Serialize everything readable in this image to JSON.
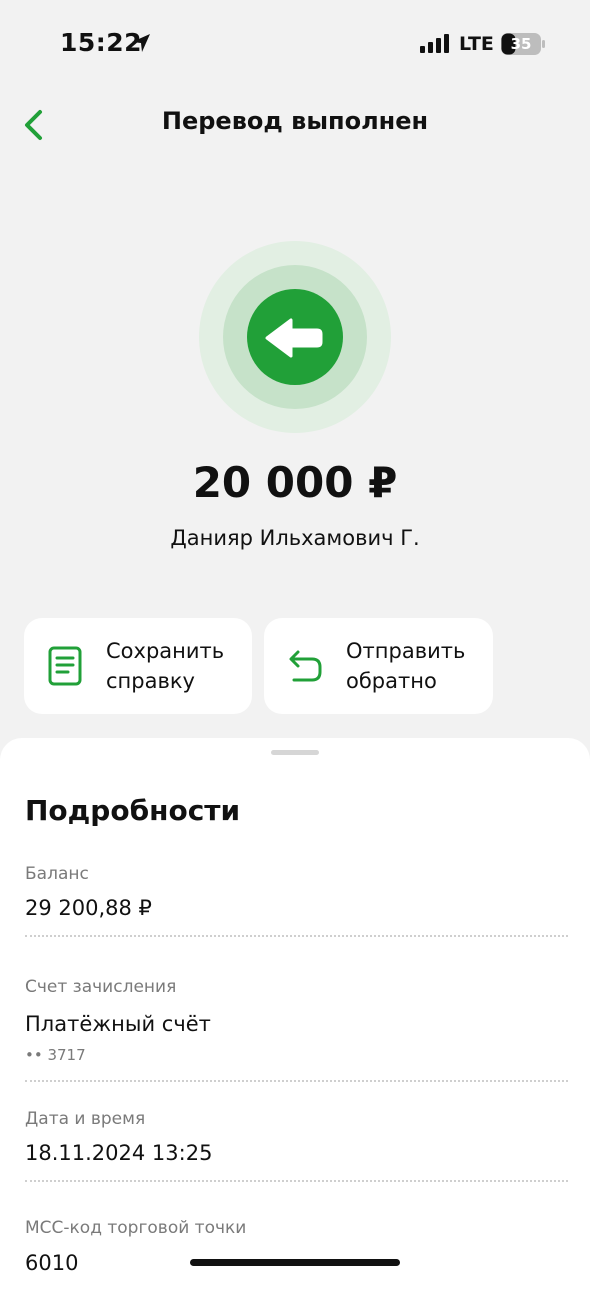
{
  "status_bar": {
    "time": "15:22",
    "network": "LTE",
    "battery": "35"
  },
  "header": {
    "title": "Перевод выполнен"
  },
  "transfer": {
    "amount": "20 000 ₽",
    "recipient": "Данияр Ильхамович Г."
  },
  "actions": {
    "save_label": "Сохранить\nсправку",
    "send_back_label": "Отправить\nобратно"
  },
  "details": {
    "title": "Подробности",
    "balance_label": "Баланс",
    "balance_value": "29 200,88 ₽",
    "account_label": "Счет зачисления",
    "account_value": "Платёжный счёт",
    "account_number": "•• 3717",
    "datetime_label": "Дата и время",
    "datetime_value": "18.11.2024 13:25",
    "mcc_label": "MCC-код торговой точки",
    "mcc_value": "6010"
  },
  "colors": {
    "accent": "#21a038",
    "background": "#f2f2f2",
    "card": "#ffffff"
  },
  "icons": {
    "back": "chevron-left-icon",
    "hero": "arrow-left-icon",
    "save": "document-icon",
    "send_back": "return-arrow-icon"
  }
}
